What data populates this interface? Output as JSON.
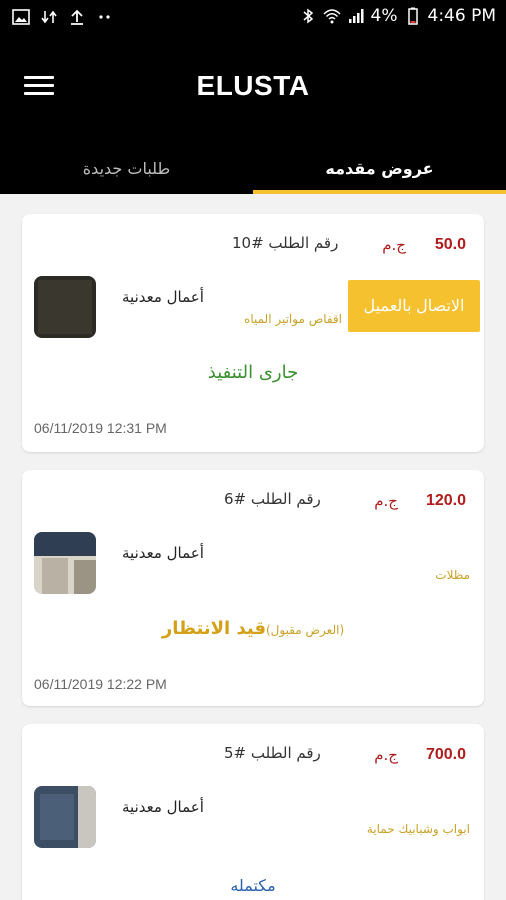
{
  "status_bar": {
    "time": "4:46 PM",
    "battery": "4%",
    "icons": [
      "image-icon",
      "data-arrows-icon",
      "upload-icon",
      "dots-icon",
      "bluetooth-icon",
      "wifi-icon",
      "signal-icon",
      "battery-icon"
    ]
  },
  "header": {
    "title": "ELUSTA"
  },
  "tabs": [
    {
      "label": "طلبات جديدة",
      "active": false
    },
    {
      "label": "عروض مقدمه",
      "active": true
    }
  ],
  "orders": [
    {
      "price": "50.0",
      "currency": "ج.م",
      "order_number": "رقم الطلب #10",
      "category": "أعمال معدنية",
      "subcategory": "اقفاص مواتير المياه",
      "call_button": "الاتصال بالعميل",
      "status": "جارى التنفيذ",
      "status_note": "",
      "date": "06/11/2019 12:31 PM"
    },
    {
      "price": "120.0",
      "currency": "ج.م",
      "order_number": "رقم الطلب #6",
      "category": "أعمال معدنية",
      "subcategory": "مظلات",
      "call_button": "",
      "status": "قيد الانتظار",
      "status_note": "(العرض مقبول)",
      "date": "06/11/2019 12:22 PM"
    },
    {
      "price": "700.0",
      "currency": "ج.م",
      "order_number": "رقم الطلب #5",
      "category": "أعمال معدنية",
      "subcategory": "ابواب وشبابيك حماية",
      "call_button": "",
      "status": "مكتمله",
      "status_note": "",
      "date": ""
    }
  ],
  "colors": {
    "accent": "#f5c12e",
    "price": "#b01c1c",
    "in_progress": "#3a8f2f",
    "pending": "#d4a017",
    "completed": "#2a62b0"
  }
}
